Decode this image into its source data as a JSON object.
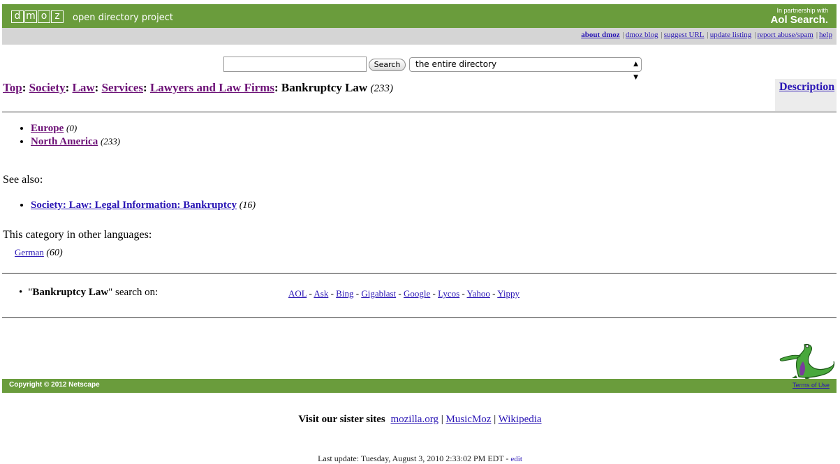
{
  "header": {
    "logo_letters": [
      "d",
      "m",
      "o",
      "z"
    ],
    "tagline": "open directory project",
    "partner_small": "In partnership with",
    "partner_big": "Aol Search."
  },
  "toplinks": [
    {
      "label": "about dmoz",
      "bold": true
    },
    {
      "label": "dmoz blog"
    },
    {
      "label": "suggest URL"
    },
    {
      "label": "update listing"
    },
    {
      "label": "report abuse/spam"
    },
    {
      "label": "help"
    }
  ],
  "search": {
    "query": "",
    "button_label": "Search",
    "scope": "the entire directory"
  },
  "breadcrumb": {
    "items": [
      "Top",
      "Society",
      "Law",
      "Services",
      "Lawyers and Law Firms"
    ],
    "current": "Bankruptcy Law",
    "count": "(233)"
  },
  "description_link": "Description",
  "subcategories": [
    {
      "label": "Europe",
      "count": "(0)"
    },
    {
      "label": "North America",
      "count": "(233)"
    }
  ],
  "see_also": {
    "heading": "See also:",
    "items": [
      {
        "label": "Society: Law: Legal Information: Bankruptcy",
        "count": "(16)"
      }
    ]
  },
  "other_languages": {
    "heading": "This category in other languages:",
    "items": [
      {
        "label": "German",
        "count": "(60)"
      }
    ]
  },
  "search_on": {
    "quote_open": "\"",
    "term": "Bankruptcy Law",
    "suffix": "\" search on:",
    "engines": [
      "AOL",
      "Ask",
      "Bing",
      "Gigablast",
      "Google",
      "Lycos",
      "Yahoo",
      "Yippy"
    ]
  },
  "footer": {
    "copyright": "Copyright © 2012 Netscape",
    "terms": "Terms of Use",
    "sister_label": "Visit our sister sites",
    "sister_sites": [
      "mozilla.org",
      "MusicMoz",
      "Wikipedia"
    ],
    "last_update": "Last update: Tuesday, August 3, 2010 2:33:02 PM EDT",
    "edit_label": "edit"
  },
  "colors": {
    "green_bar": "#6a9c3c",
    "link": "#2a16b5",
    "visited": "#6b0f75",
    "gray_bar": "#d5d5d5"
  }
}
